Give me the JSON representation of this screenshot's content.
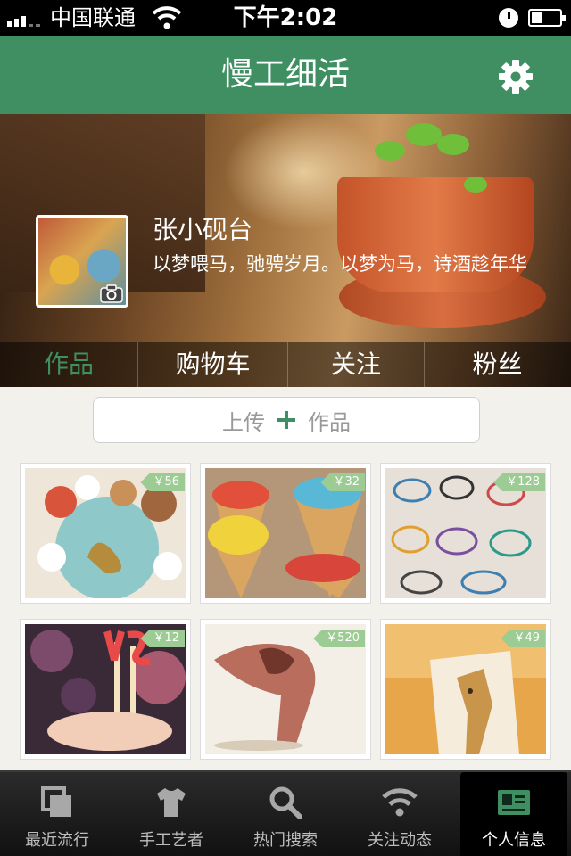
{
  "status_bar": {
    "carrier": "中国联通",
    "time": "下午2:02"
  },
  "nav": {
    "title": "慢工细活"
  },
  "profile": {
    "name": "张小砚台",
    "bio": "以梦喂马，驰骋岁月。以梦为马，诗酒趁年华"
  },
  "profile_tabs": [
    {
      "label": "作品",
      "active": true
    },
    {
      "label": "购物车",
      "active": false
    },
    {
      "label": "关注",
      "active": false
    },
    {
      "label": "粉丝",
      "active": false
    }
  ],
  "upload": {
    "left": "上传",
    "right": "作品"
  },
  "products": [
    {
      "price": "￥56",
      "subject": "felt animal toys"
    },
    {
      "price": "￥32",
      "subject": "ice cream cone cookies"
    },
    {
      "price": "￥128",
      "subject": "beaded bracelets"
    },
    {
      "price": "￥12",
      "subject": "nail art pencils"
    },
    {
      "price": "￥520",
      "subject": "watercolor painting"
    },
    {
      "price": "￥49",
      "subject": "giraffe card"
    }
  ],
  "tab_bar": [
    {
      "label": "最近流行",
      "icon": "layers-icon",
      "active": false
    },
    {
      "label": "手工艺者",
      "icon": "tshirt-icon",
      "active": false
    },
    {
      "label": "热门搜索",
      "icon": "search-icon",
      "active": false
    },
    {
      "label": "关注动态",
      "icon": "wifi-icon",
      "active": false
    },
    {
      "label": "个人信息",
      "icon": "id-card-icon",
      "active": true
    }
  ],
  "colors": {
    "accent": "#3f8f63",
    "price_tag": "#9ccc94",
    "tab_bar": "#1a1a1a"
  }
}
